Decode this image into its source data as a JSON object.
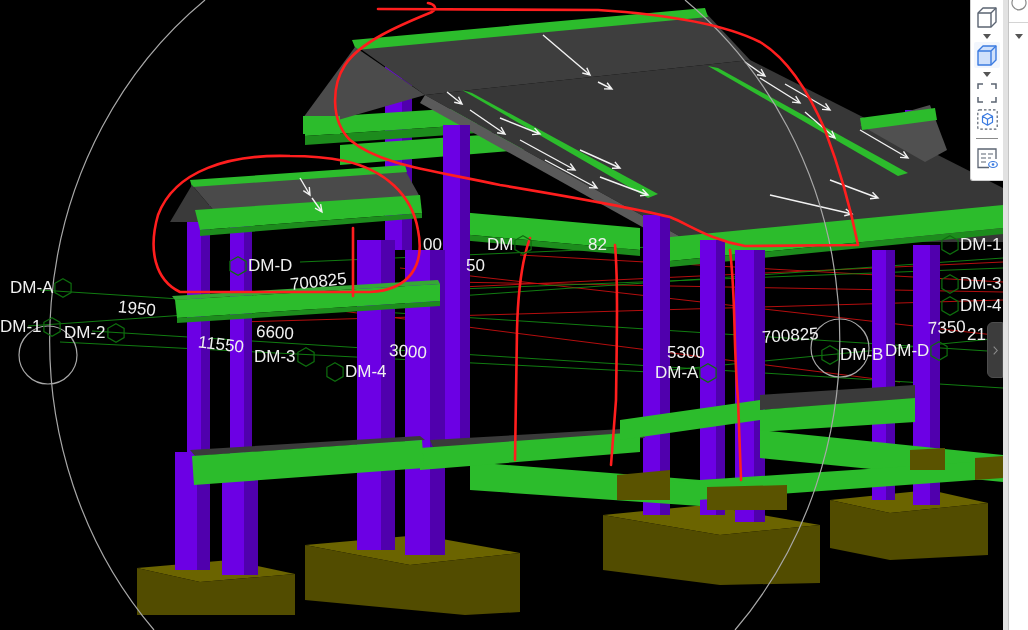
{
  "viewport": {
    "labels": [
      {
        "text": "00",
        "kind": "dimension"
      },
      {
        "text": "DM",
        "kind": "axis"
      },
      {
        "text": "82",
        "kind": "dimension"
      },
      {
        "text": "DM-1",
        "kind": "axis"
      },
      {
        "text": "DM-D",
        "kind": "axis"
      },
      {
        "text": "50",
        "kind": "dimension"
      },
      {
        "text": "DM-A",
        "kind": "axis"
      },
      {
        "text": "700825",
        "kind": "dimension"
      },
      {
        "text": "DM-3",
        "kind": "axis"
      },
      {
        "text": "1950",
        "kind": "dimension"
      },
      {
        "text": "DM-4",
        "kind": "axis"
      },
      {
        "text": "DM-1",
        "kind": "axis"
      },
      {
        "text": "DM-2",
        "kind": "axis"
      },
      {
        "text": "11550",
        "kind": "dimension"
      },
      {
        "text": "6600",
        "kind": "dimension"
      },
      {
        "text": "700825",
        "kind": "dimension"
      },
      {
        "text": "7350",
        "kind": "dimension"
      },
      {
        "text": "21",
        "kind": "dimension"
      },
      {
        "text": "DM-3",
        "kind": "axis"
      },
      {
        "text": "3000",
        "kind": "dimension"
      },
      {
        "text": "5300",
        "kind": "dimension"
      },
      {
        "text": "DM-B",
        "kind": "axis"
      },
      {
        "text": "DM-D",
        "kind": "axis"
      },
      {
        "text": "DM-4",
        "kind": "axis"
      },
      {
        "text": "DM-A",
        "kind": "axis"
      }
    ]
  },
  "toolbar": {
    "groups": [
      [
        {
          "kind": "cube",
          "selected": false,
          "dropdown": true
        },
        {
          "kind": "cube",
          "selected": true,
          "dropdown": true
        },
        {
          "kind": "box-select",
          "selected": false,
          "dropdown": false
        },
        {
          "kind": "section-box",
          "selected": false,
          "dropdown": false
        }
      ],
      [
        {
          "kind": "properties",
          "selected": false,
          "dropdown": false
        }
      ]
    ]
  }
}
